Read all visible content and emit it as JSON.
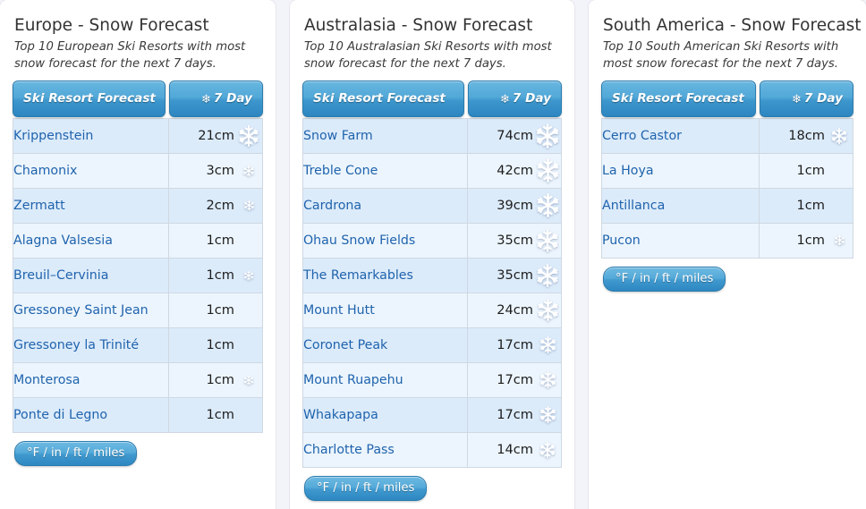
{
  "theme": {
    "page_background": "#f3f3fa",
    "panel_background": "#ffffff",
    "header_accent": "#2d86c0",
    "link_color": "#1f63ad",
    "row_odd": "#dcebfa",
    "row_even": "#ecf5fd"
  },
  "units_button_label": "°F / in / ft / miles",
  "columns": {
    "resort_header": "Ski Resort Forecast",
    "day_header": "7 Day",
    "day_header_icon": "snowflake-icon"
  },
  "panels": [
    {
      "id": "europe",
      "title": "Europe - Snow Forecast",
      "subtitle": "Top 10 European Ski Resorts with most snow forecast for the next 7 days.",
      "rows": [
        {
          "resort": "Krippenstein",
          "amount": "21cm",
          "value": 21,
          "flake": 26
        },
        {
          "resort": "Chamonix",
          "amount": "3cm",
          "value": 3,
          "flake": 14
        },
        {
          "resort": "Zermatt",
          "amount": "2cm",
          "value": 2,
          "flake": 13
        },
        {
          "resort": "Alagna Valsesia",
          "amount": "1cm",
          "value": 1,
          "flake": 0
        },
        {
          "resort": "Breuil–Cervinia",
          "amount": "1cm",
          "value": 1,
          "flake": 12
        },
        {
          "resort": "Gressoney Saint Jean",
          "amount": "1cm",
          "value": 1,
          "flake": 0
        },
        {
          "resort": "Gressoney la Trinité",
          "amount": "1cm",
          "value": 1,
          "flake": 0
        },
        {
          "resort": "Monterosa",
          "amount": "1cm",
          "value": 1,
          "flake": 12
        },
        {
          "resort": "Ponte di Legno",
          "amount": "1cm",
          "value": 1,
          "flake": 0
        }
      ]
    },
    {
      "id": "australasia",
      "title": "Australasia - Snow Forecast",
      "subtitle": "Top 10 Australasian Ski Resorts with most snow forecast for the next 7 days.",
      "rows": [
        {
          "resort": "Snow Farm",
          "amount": "74cm",
          "value": 74,
          "flake": 30
        },
        {
          "resort": "Treble Cone",
          "amount": "42cm",
          "value": 42,
          "flake": 29
        },
        {
          "resort": "Cardrona",
          "amount": "39cm",
          "value": 39,
          "flake": 29
        },
        {
          "resort": "Ohau Snow Fields",
          "amount": "35cm",
          "value": 35,
          "flake": 28
        },
        {
          "resort": "The Remarkables",
          "amount": "35cm",
          "value": 35,
          "flake": 28
        },
        {
          "resort": "Mount Hutt",
          "amount": "24cm",
          "value": 24,
          "flake": 27
        },
        {
          "resort": "Coronet Peak",
          "amount": "17cm",
          "value": 17,
          "flake": 21
        },
        {
          "resort": "Mount Ruapehu",
          "amount": "17cm",
          "value": 17,
          "flake": 21
        },
        {
          "resort": "Whakapapa",
          "amount": "17cm",
          "value": 17,
          "flake": 21
        },
        {
          "resort": "Charlotte Pass",
          "amount": "14cm",
          "value": 14,
          "flake": 20
        }
      ]
    },
    {
      "id": "south-america",
      "title": "South America - Snow Forecast",
      "subtitle": "Top 10 South American Ski Resorts with most snow forecast for the next 7 days.",
      "rows": [
        {
          "resort": "Cerro Castor",
          "amount": "18cm",
          "value": 18,
          "flake": 20
        },
        {
          "resort": "La Hoya",
          "amount": "1cm",
          "value": 1,
          "flake": 0
        },
        {
          "resort": "Antillanca",
          "amount": "1cm",
          "value": 1,
          "flake": 0
        },
        {
          "resort": "Pucon",
          "amount": "1cm",
          "value": 1,
          "flake": 13
        }
      ]
    }
  ]
}
